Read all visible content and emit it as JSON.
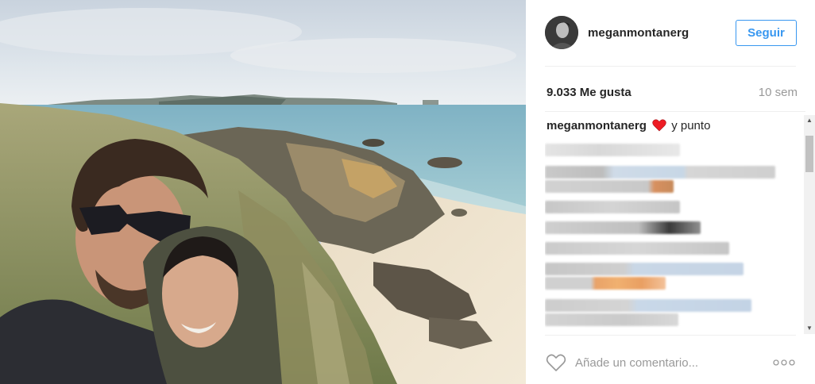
{
  "post": {
    "username": "meganmontanerg",
    "follow_label": "Seguir",
    "likes": "9.033 Me gusta",
    "time_ago": "10 sem",
    "caption_user": "meganmontanerg",
    "caption_text": "y punto",
    "caption_emoji": "red-heart-icon",
    "comment_placeholder": "Añade un comentario...",
    "more_label": "more-options-icon"
  },
  "colors": {
    "accent": "#3897f0",
    "text": "#262626",
    "muted": "#999999",
    "heart": "#ed1c24"
  }
}
